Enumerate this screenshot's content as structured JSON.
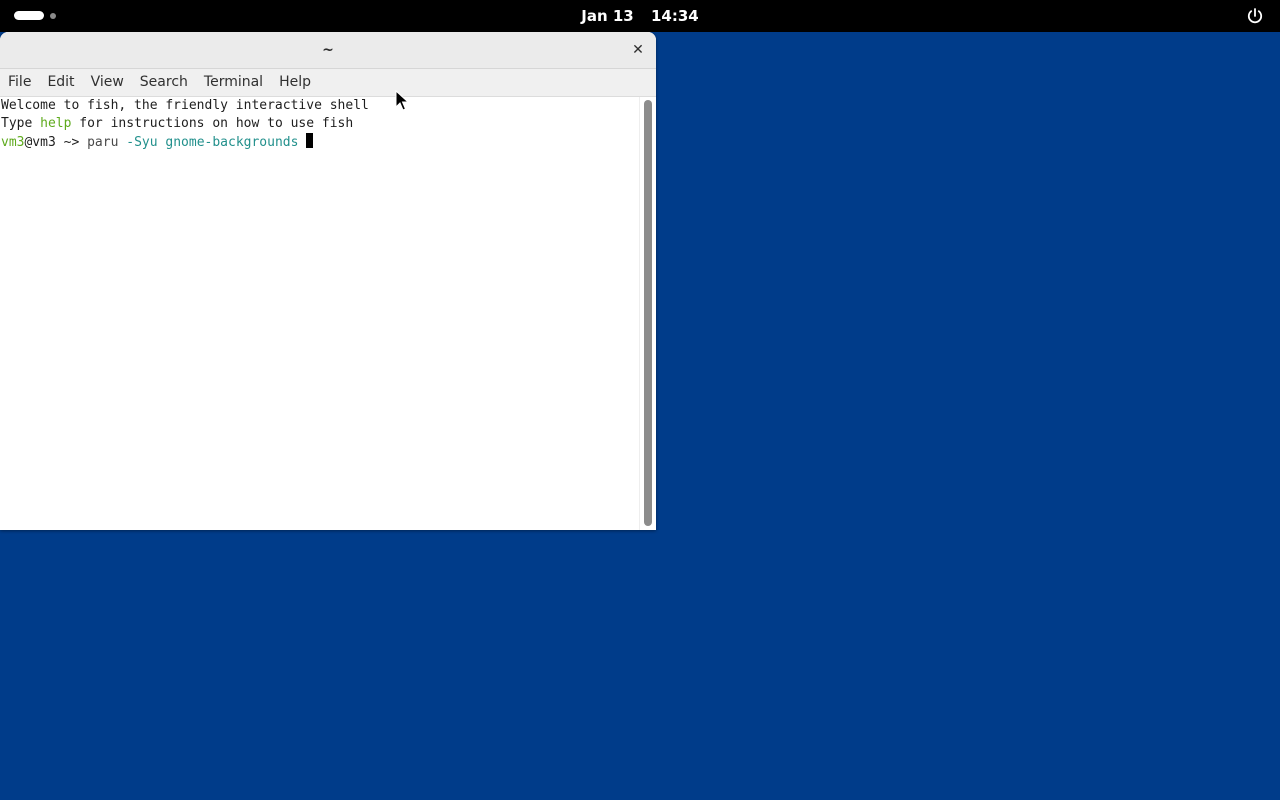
{
  "topbar": {
    "clock_date": "Jan 13",
    "clock_time": "14:34",
    "workspace_indicator": "activities-workspace-dots",
    "power_icon": "power-icon"
  },
  "window": {
    "title": "~",
    "close_label": "✕",
    "menu": [
      "File",
      "Edit",
      "View",
      "Search",
      "Terminal",
      "Help"
    ]
  },
  "terminal": {
    "line1": "Welcome to fish, the friendly interactive shell",
    "line2_before": "Type ",
    "line2_help": "help",
    "line2_after": " for instructions on how to use fish",
    "prompt_user": "vm3",
    "prompt_at_host": "@vm3",
    "prompt_path": " ~> ",
    "cmd_name": "paru",
    "cmd_flag": " -Syu",
    "cmd_arg": " gnome-backgrounds"
  },
  "colors": {
    "desktop": "#003c8a",
    "topbar": "#000000",
    "prompt_user": "#5faa1e",
    "command": "#22908c"
  }
}
